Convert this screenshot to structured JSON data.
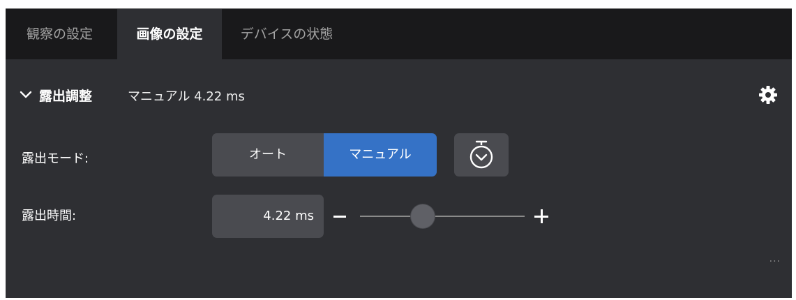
{
  "tabs": [
    {
      "label": "観察の設定",
      "active": false
    },
    {
      "label": "画像の設定",
      "active": true
    },
    {
      "label": "デバイスの状態",
      "active": false
    }
  ],
  "section": {
    "title": "露出調整",
    "summary": "マニュアル 4.22 ms",
    "expanded": true,
    "icons": {
      "collapse": "chevron-down-icon",
      "settings": "gear-icon"
    }
  },
  "exposure_mode": {
    "label": "露出モード:",
    "options": [
      "オート",
      "マニュアル"
    ],
    "selected": "マニュアル",
    "timer_icon": "stopwatch-icon"
  },
  "exposure_time": {
    "label": "露出時間:",
    "value": "4.22 ms",
    "slider_position": 0.38,
    "minus_icon": "minus-icon",
    "plus_icon": "plus-icon"
  },
  "more_label": "...",
  "colors": {
    "panel_bg": "#2e2f33",
    "tabbar_bg": "#19191b",
    "accent": "#3572c6",
    "control_bg": "#4a4b50"
  }
}
